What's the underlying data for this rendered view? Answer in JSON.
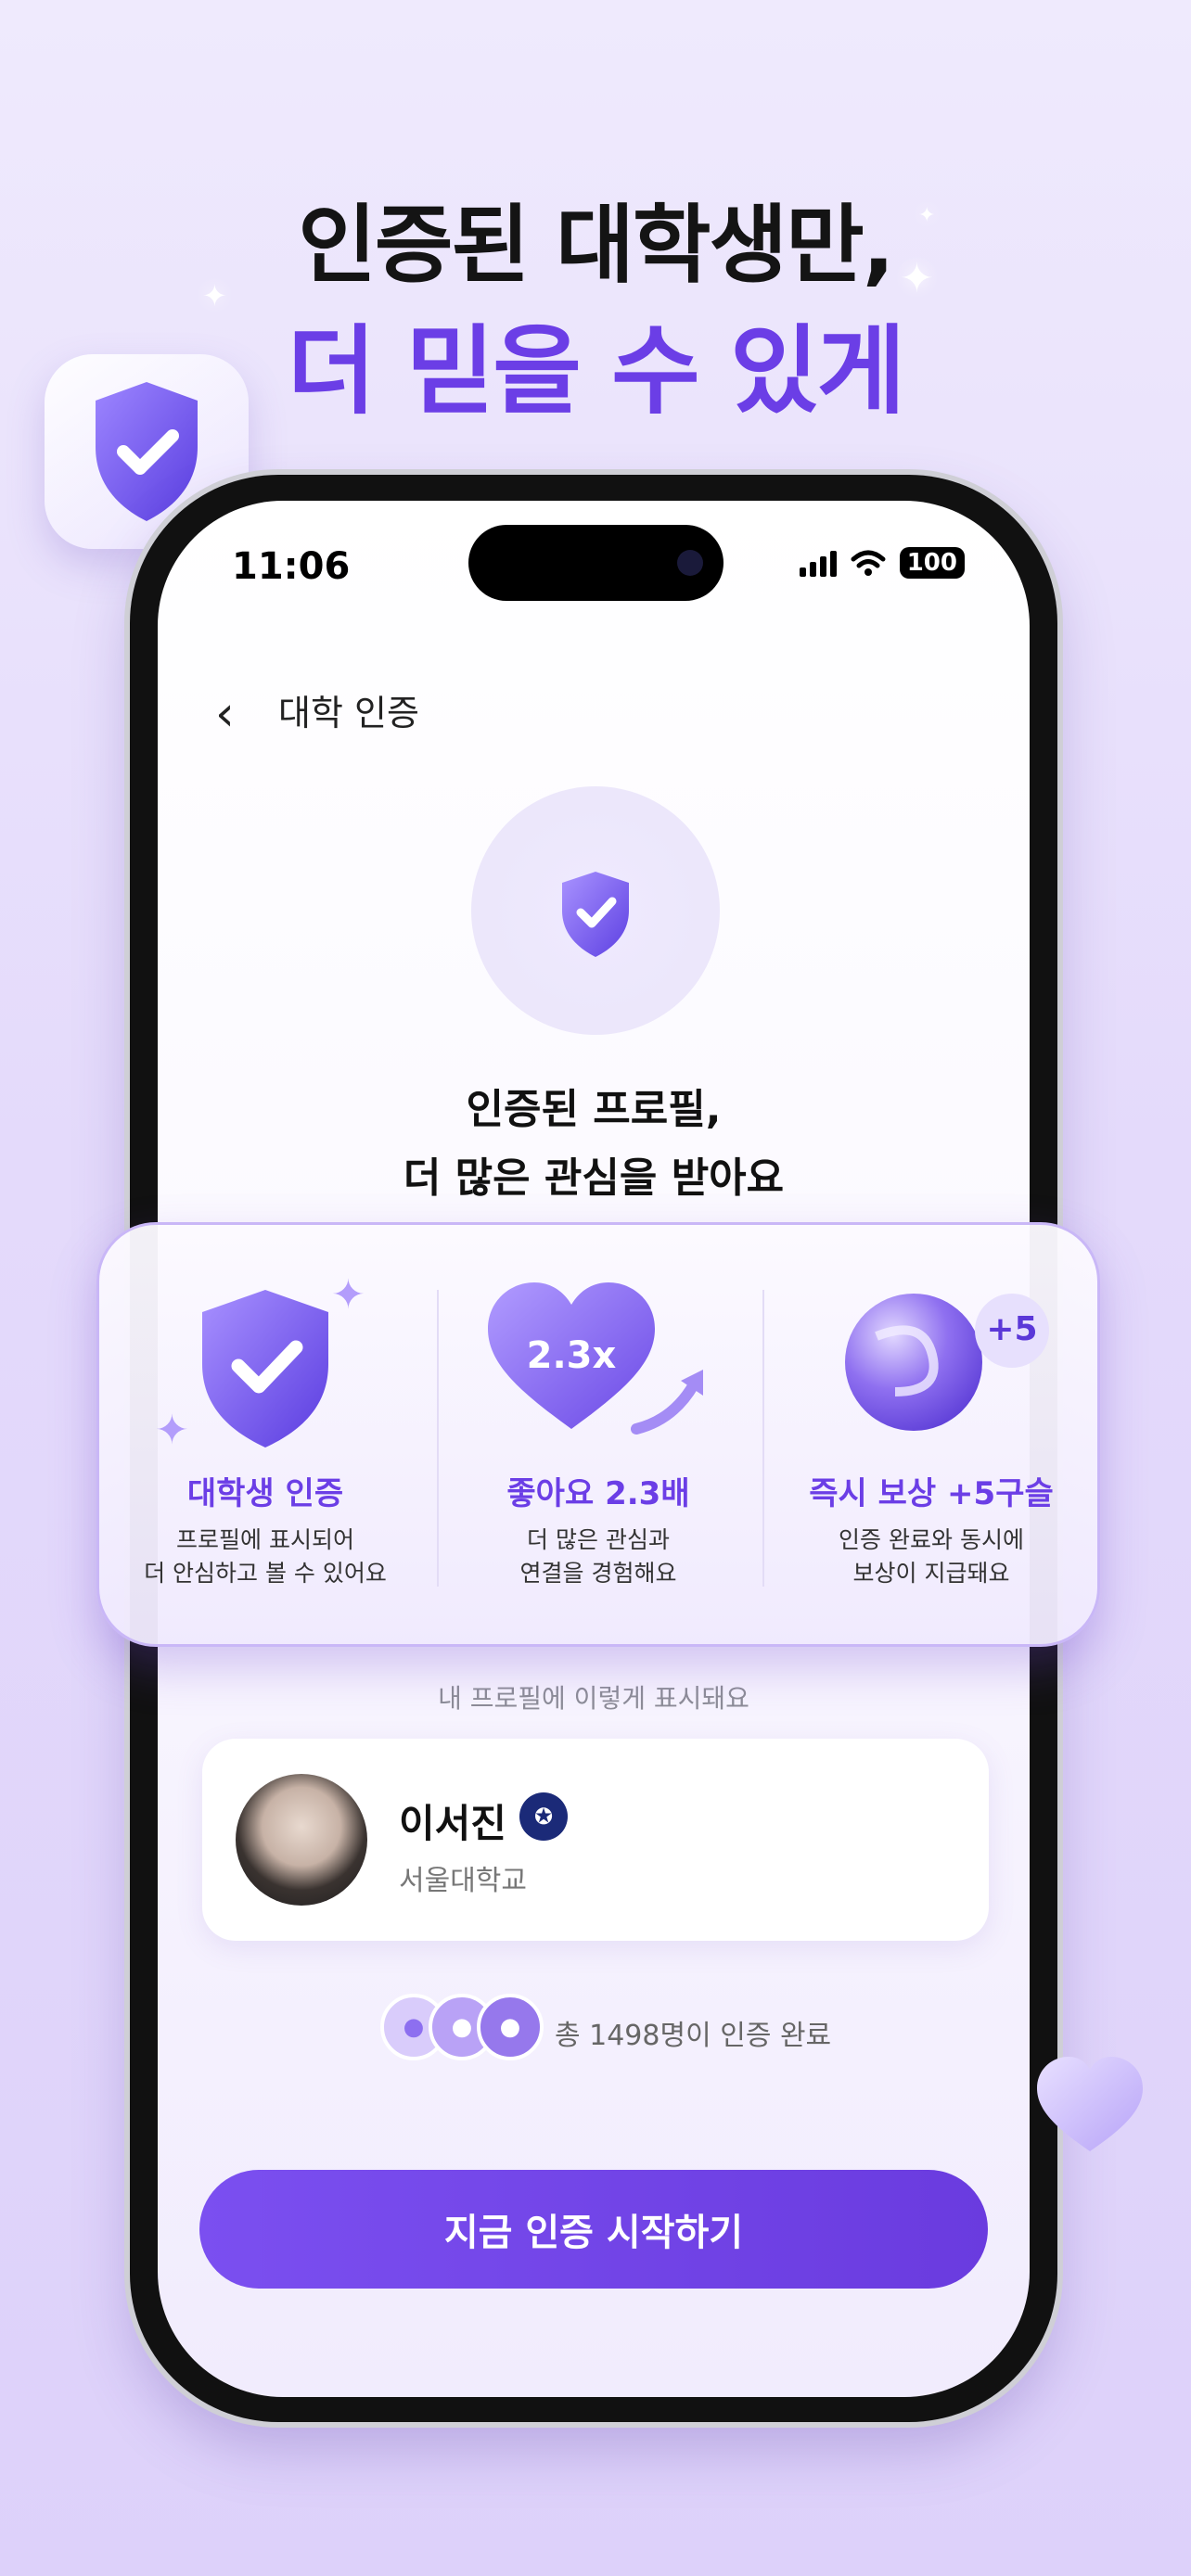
{
  "headline": {
    "line1": "인증된 대학생만,",
    "line2": "더 믿을 수 있게"
  },
  "status_bar": {
    "time": "11:06",
    "battery": "100"
  },
  "nav": {
    "back_icon": "chevron-left-icon",
    "title": "대학 인증"
  },
  "hero": {
    "title_line1": "인증된 프로필,",
    "title_line2": "더 많은 관심을 받아요"
  },
  "features": [
    {
      "icon": "shield-check-icon",
      "title": "대학생 인증",
      "desc_line1": "프로필에 표시되어",
      "desc_line2": "더 안심하고 볼 수 있어요"
    },
    {
      "icon": "heart-icon",
      "badge": "2.3x",
      "title": "좋아요 2.3배",
      "desc_line1": "더 많은 관심과",
      "desc_line2": "연결을 경험해요"
    },
    {
      "icon": "orb-coin-icon",
      "badge": "+5",
      "title": "즉시 보상 +5구슬",
      "desc_line1": "인증 완료와 동시에",
      "desc_line2": "보상이 지급돼요"
    }
  ],
  "preview": {
    "label": "내 프로필에 이렇게 표시돼요",
    "name": "이서진",
    "university": "서울대학교",
    "emblem_icon": "university-emblem-icon"
  },
  "verified": {
    "text": "총 1498명이 인증 완료"
  },
  "cta": {
    "label": "지금 인증 시작하기"
  },
  "colors": {
    "accent": "#6b3ee6",
    "button": "#7148ea",
    "background": "#e4dafb"
  }
}
